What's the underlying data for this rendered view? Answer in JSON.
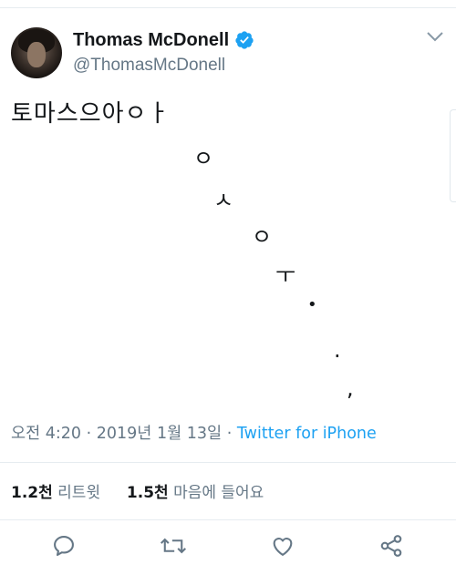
{
  "user": {
    "display_name": "Thomas McDonell",
    "handle": "@ThomasMcDonell",
    "verified": true
  },
  "tweet": {
    "text_line": "토마스으아ㅇㅏ",
    "glyphs": [
      "ㅇ",
      "ㅅ",
      "ㅇ",
      "ㅜ",
      "•",
      ".",
      ","
    ],
    "timestamp": "오전 4:20 · 2019년 1월 13일",
    "separator": "·",
    "source": "Twitter for iPhone"
  },
  "stats": {
    "retweets_count": "1.2천",
    "retweets_label": "리트윗",
    "likes_count": "1.5천",
    "likes_label": "마음에 들어요"
  },
  "colors": {
    "link": "#1da1f2",
    "secondary_text": "#657786",
    "verified_badge": "#1da1f2"
  },
  "icons": [
    "verified-badge-icon",
    "chevron-down-icon",
    "reply-icon",
    "retweet-icon",
    "like-icon",
    "share-icon"
  ]
}
